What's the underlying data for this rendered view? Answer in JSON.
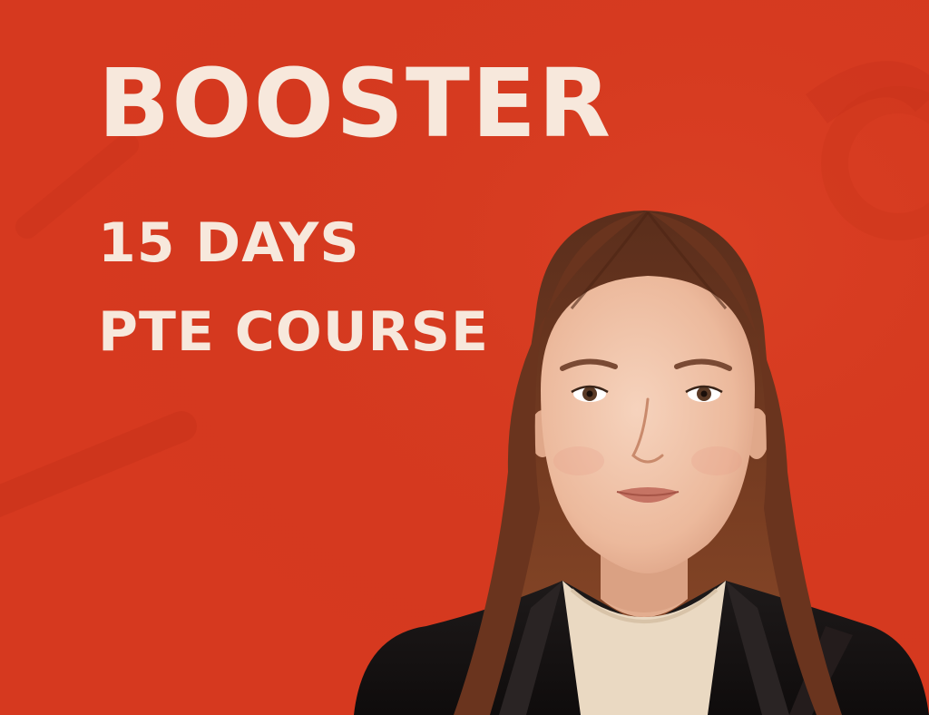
{
  "poster": {
    "headline": "BOOSTER",
    "duration": "15 DAYS",
    "course": "PTE COURSE",
    "colors": {
      "background": "#d6391f",
      "text": "#f7e8dc"
    }
  },
  "portrait": {
    "icon": "woman-portrait-photo"
  }
}
